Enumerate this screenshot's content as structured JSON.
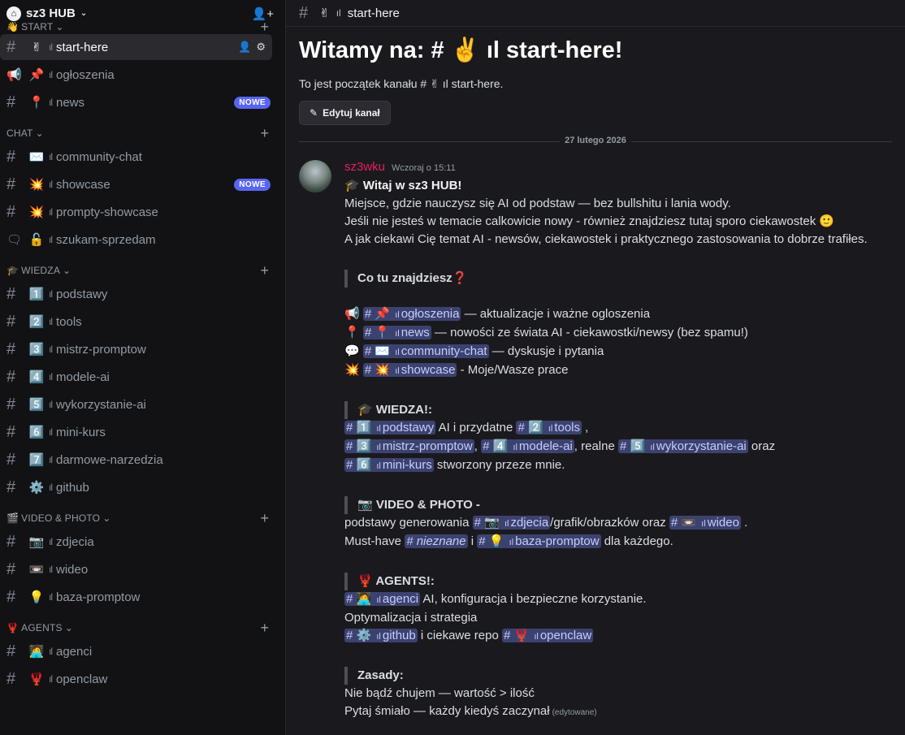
{
  "server": {
    "name": "sz3 HUB"
  },
  "sidebar": {
    "categories": [
      {
        "label": "START",
        "emoji": "👋"
      },
      {
        "label": "CHAT",
        "emoji": ""
      },
      {
        "label": "WIEDZA",
        "emoji": "🎓"
      },
      {
        "label": "VIDEO & PHOTO",
        "emoji": "🎬"
      },
      {
        "label": "AGENTS",
        "emoji": "🦞"
      }
    ],
    "channels": [
      {
        "icon": "#",
        "emoji": "✌",
        "name": "start-here",
        "badge": ""
      },
      {
        "icon": "📢",
        "emoji": "📌",
        "name": "ogłoszenia",
        "badge": ""
      },
      {
        "icon": "#",
        "emoji": "📍",
        "name": "news",
        "badge": "NOWE"
      },
      {
        "icon": "#",
        "emoji": "✉️",
        "name": "community-chat",
        "badge": ""
      },
      {
        "icon": "#",
        "emoji": "💥",
        "name": "showcase",
        "badge": "NOWE"
      },
      {
        "icon": "#",
        "emoji": "💥",
        "name": "prompty-showcase",
        "badge": ""
      },
      {
        "icon": "💬",
        "emoji": "🔓",
        "name": "szukam-sprzedam",
        "badge": ""
      },
      {
        "icon": "#",
        "emoji": "1️⃣",
        "name": "podstawy",
        "badge": ""
      },
      {
        "icon": "#",
        "emoji": "2️⃣",
        "name": "tools",
        "badge": ""
      },
      {
        "icon": "#",
        "emoji": "3️⃣",
        "name": "mistrz-promptow",
        "badge": ""
      },
      {
        "icon": "#",
        "emoji": "4️⃣",
        "name": "modele-ai",
        "badge": ""
      },
      {
        "icon": "#",
        "emoji": "5️⃣",
        "name": "wykorzystanie-ai",
        "badge": ""
      },
      {
        "icon": "#",
        "emoji": "6️⃣",
        "name": "mini-kurs",
        "badge": ""
      },
      {
        "icon": "#",
        "emoji": "7️⃣",
        "name": "darmowe-narzedzia",
        "badge": ""
      },
      {
        "icon": "#",
        "emoji": "⚙️",
        "name": "github",
        "badge": ""
      },
      {
        "icon": "#",
        "emoji": "📷",
        "name": "zdjecia",
        "badge": ""
      },
      {
        "icon": "#",
        "emoji": "📼",
        "name": "wideo",
        "badge": ""
      },
      {
        "icon": "#",
        "emoji": "💡",
        "name": "baza-promptow",
        "badge": ""
      },
      {
        "icon": "#",
        "emoji": "🧑‍💻",
        "name": "agenci",
        "badge": ""
      },
      {
        "icon": "#",
        "emoji": "🦞",
        "name": "openclaw",
        "badge": ""
      }
    ]
  },
  "topbar": {
    "channel_emoji": "✌",
    "channel_name": "start-here"
  },
  "welcome": {
    "title": "Witamy na: # ✌️ ıl start-here!",
    "subtitle": "To jest początek kanału # ✌ ıl start-here.",
    "edit_button": "Edytuj kanał"
  },
  "date_divider": "27 lutego 2026",
  "message": {
    "author": "sz3wku",
    "timestamp": "Wczoraj o 15:11",
    "heading": "Witaj w sz3 HUB!",
    "p1": "Miejsce, gdzie nauczysz się AI od podstaw — bez bullshitu i lania wody.",
    "p2": "Jeśli nie jesteś w temacie calkowicie nowy - również znajdziesz tutaj sporo ciekawostek 🙂",
    "p3": "A jak ciekawi Cię temat AI - newsów, ciekawostek i praktycznego zastosowania to dobrze trafiłes.",
    "q1": "Co tu znajdziesz❓",
    "l1_text": "— aktualizacje i ważne ogloszenia",
    "l2_text": "— nowości ze świata AI - ciekawostki/newsy (bez spamu!)",
    "l3_text": "— dyskusje i pytania",
    "l4_text": "- Moje/Wasze prace",
    "q2": "WIEDZA!:",
    "w1_text": "AI i przydatne",
    "w2_text": ", realne",
    "w2_end": "oraz",
    "w3_text": "stworzony przeze mnie.",
    "q3": "📷 VIDEO & PHOTO -",
    "v1_start": "podstawy generowania",
    "v1_mid": "/grafik/obrazków oraz",
    "v2_start": "Must-have",
    "v2_mention": "nieznane",
    "v2_mid": "i",
    "v2_end": "dla każdego.",
    "q4": "AGENTS!:",
    "a1_text": "AI, konfiguracja i bezpieczne korzystanie.",
    "a2": "Optymalizacja i strategia",
    "a3_text": "i ciekawe repo",
    "q5": "Zasady:",
    "r1": "Nie bądź chujem — wartość > ilość",
    "r2": "Pytaj śmiało — każdy kiedyś zaczynał",
    "edited": "(edytowane)"
  },
  "colors": {
    "accent": "#5865f2",
    "author": "#e91e63",
    "mention_bg": "#3c4270"
  }
}
